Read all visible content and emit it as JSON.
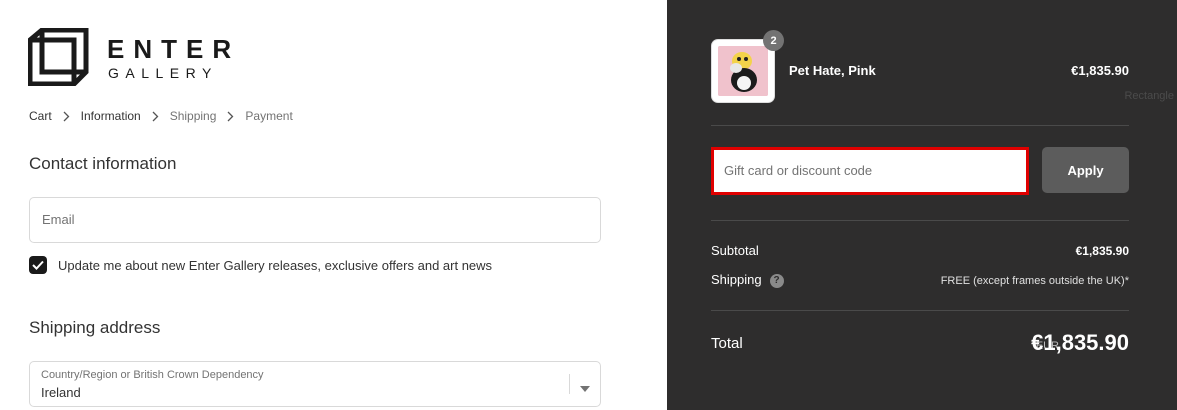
{
  "brand": {
    "line1": "ENTER",
    "line2": "GALLERY"
  },
  "breadcrumb": [
    "Cart",
    "Information",
    "Shipping",
    "Payment"
  ],
  "contact": {
    "title": "Contact information",
    "email_placeholder": "Email",
    "newsletter_label": "Update me about new Enter Gallery releases, exclusive offers and art news",
    "newsletter_checked": true
  },
  "shipping": {
    "title": "Shipping address",
    "country_label": "Country/Region or British Crown Dependency",
    "country_value": "Ireland"
  },
  "order": {
    "product": {
      "name": "Pet Hate, Pink",
      "price": "€1,835.90",
      "quantity": "2"
    },
    "annotation": "Rectangle",
    "discount_placeholder": "Gift card or discount code",
    "apply_label": "Apply",
    "subtotal_label": "Subtotal",
    "subtotal_value": "€1,835.90",
    "shipping_label": "Shipping",
    "shipping_value": "FREE (except frames outside the UK)*",
    "total_label": "Total",
    "total_currency": "EUR",
    "total_value": "€1,835.90"
  },
  "colors": {
    "panel": "#2e2d2d",
    "highlight": "#e00000",
    "button": "#5c5c5c"
  }
}
